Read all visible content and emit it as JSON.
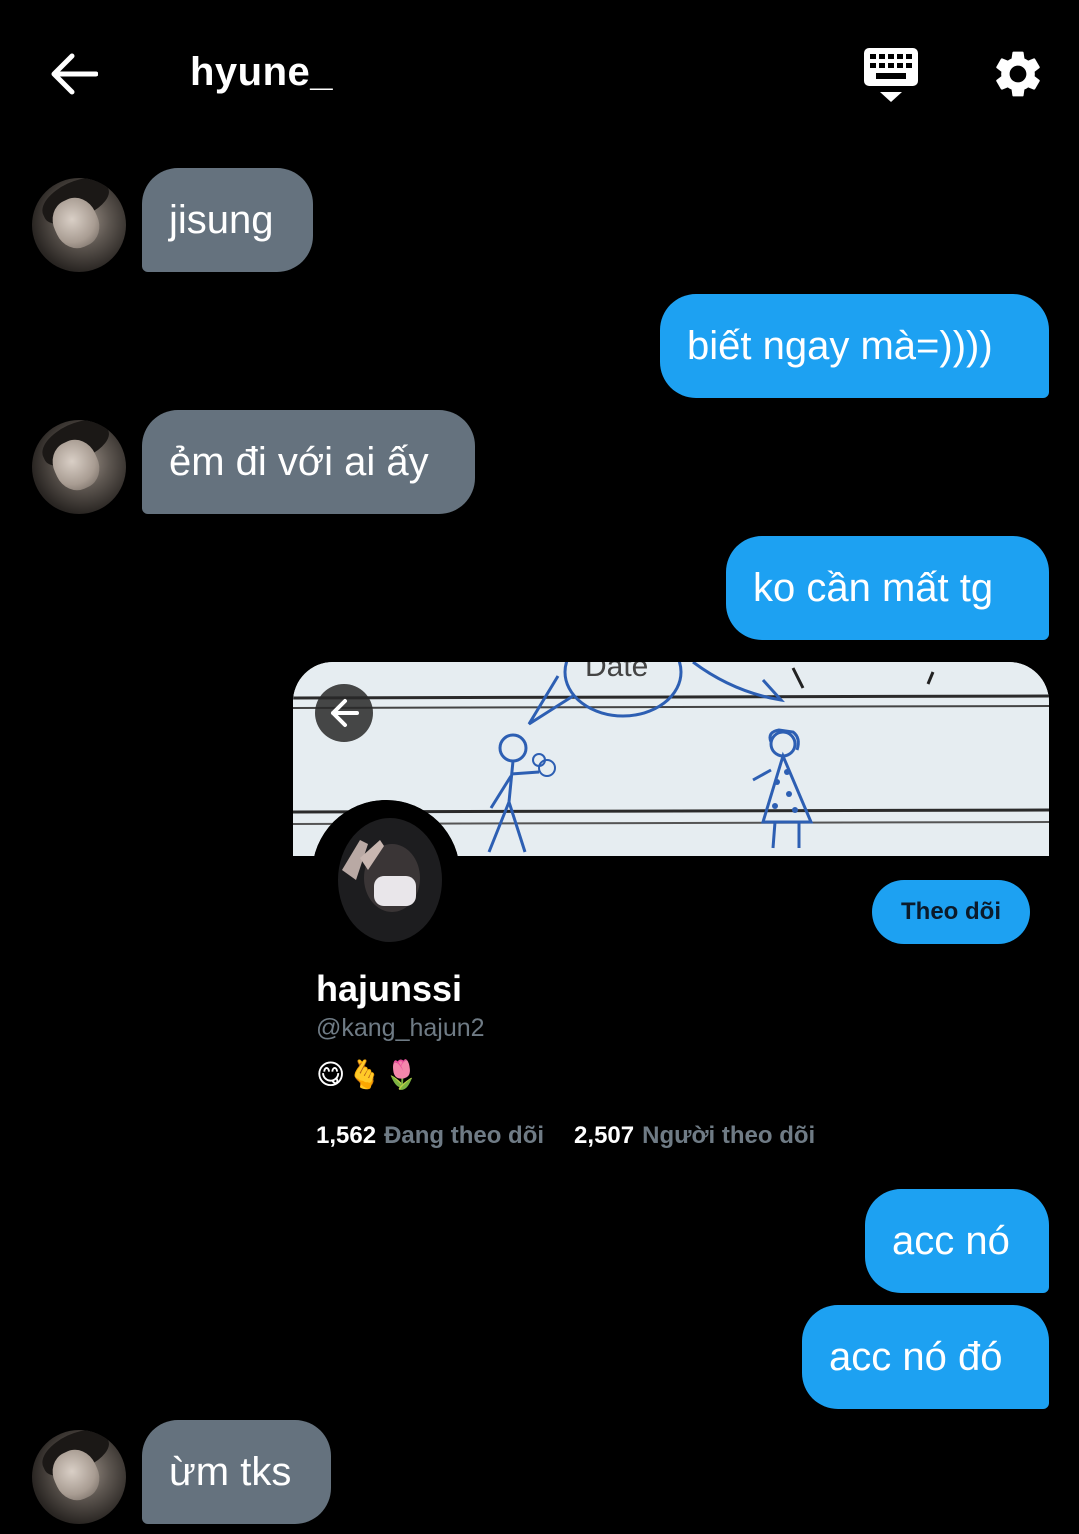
{
  "header": {
    "title": "hyune_",
    "back_icon": "arrow-left-icon",
    "keyboard_icon": "keyboard-icon",
    "settings_icon": "gear-icon"
  },
  "messages": [
    {
      "side": "in",
      "text": "jisung"
    },
    {
      "side": "out",
      "text": "biết ngay mà=))))"
    },
    {
      "side": "in",
      "text": "ẻm đi với ai ấy"
    },
    {
      "side": "out",
      "text": "ko cần mất tg"
    },
    {
      "side": "out",
      "text": "acc nó"
    },
    {
      "side": "out",
      "text": "acc nó đó"
    },
    {
      "side": "in",
      "text": "ừm tks"
    }
  ],
  "profile_card": {
    "banner_text": "Date",
    "name": "hajunssi",
    "handle": "@kang_hajun2",
    "bio_emoji": [
      "😋",
      "🫰",
      "🌷"
    ],
    "following_count": "1,562",
    "following_label": "Đang theo dõi",
    "followers_count": "2,507",
    "followers_label": "Người theo dõi",
    "follow_button_label": "Theo dõi"
  },
  "colors": {
    "background": "#000000",
    "incoming_bubble": "#65727e",
    "outgoing_bubble": "#1da1f2",
    "muted_text": "#6f7b85"
  }
}
